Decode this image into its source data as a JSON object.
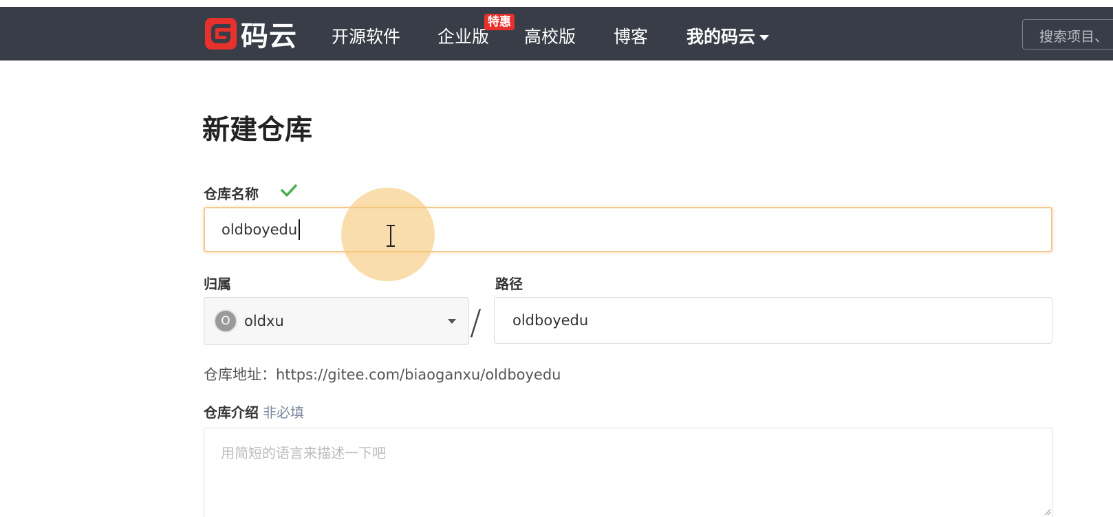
{
  "header": {
    "logo_text": "码云",
    "nav": [
      {
        "label": "开源软件"
      },
      {
        "label": "企业版"
      },
      {
        "label": "高校版"
      },
      {
        "label": "博客"
      },
      {
        "label": "我的码云"
      }
    ],
    "promo_badge": "特惠",
    "search_placeholder": "搜索项目、"
  },
  "form": {
    "title": "新建仓库",
    "repo_name_label": "仓库名称",
    "repo_name_value": "oldboyedu",
    "owner_label": "归属",
    "owner_avatar_letter": "O",
    "owner_value": "oldxu",
    "separator": "/",
    "path_label": "路径",
    "path_value": "oldboyedu",
    "repo_url_text": "仓库地址：https://gitee.com/biaoganxu/oldboyedu",
    "description_label": "仓库介绍",
    "description_optional": "非必填",
    "description_placeholder": "用简短的语言来描述一下吧"
  },
  "colors": {
    "navbar": "#383d47",
    "brand_red": "#e7312c",
    "focus_border": "#f3c88e",
    "check_green": "#4cae4c"
  }
}
